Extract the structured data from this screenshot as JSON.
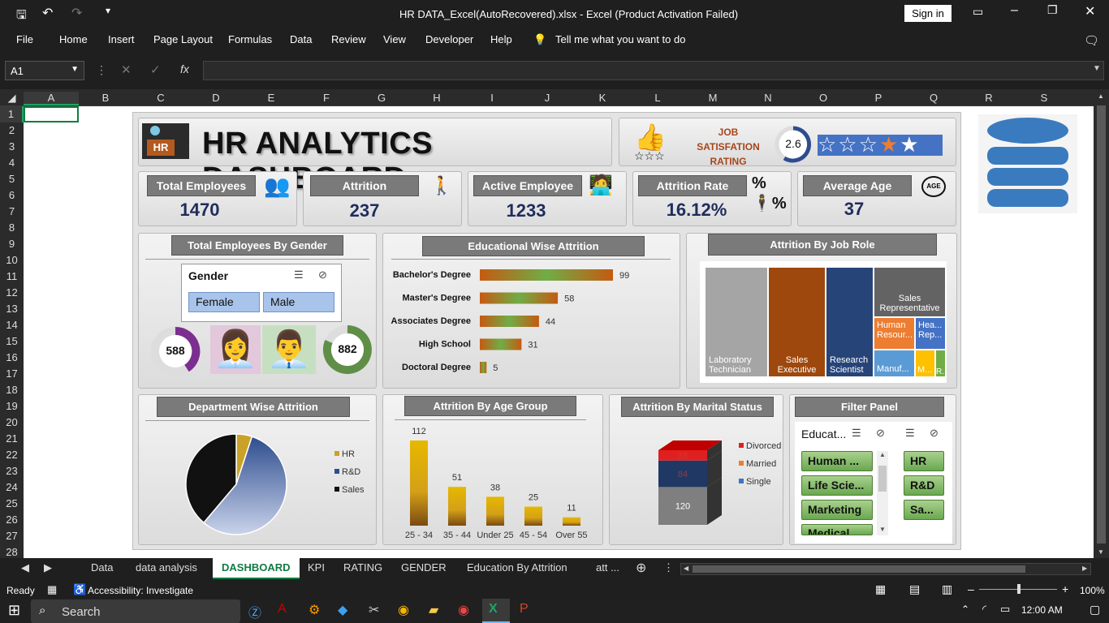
{
  "window": {
    "title": "HR DATA_Excel(AutoRecovered).xlsx  -  Excel (Product Activation Failed)",
    "sign_in": "Sign in"
  },
  "menu": [
    "File",
    "Home",
    "Insert",
    "Page Layout",
    "Formulas",
    "Data",
    "Review",
    "View",
    "Developer",
    "Help"
  ],
  "tell_me": "Tell me what you want to do",
  "formula": {
    "name_box": "A1",
    "fx": "fx"
  },
  "columns": [
    "A",
    "B",
    "C",
    "D",
    "E",
    "F",
    "G",
    "H",
    "I",
    "J",
    "K",
    "L",
    "M",
    "N",
    "O",
    "P",
    "Q",
    "R",
    "S"
  ],
  "rows": [
    "1",
    "2",
    "3",
    "4",
    "5",
    "6",
    "7",
    "8",
    "9",
    "10",
    "11",
    "12",
    "13",
    "14",
    "15",
    "16",
    "17",
    "18",
    "19",
    "20",
    "21",
    "22",
    "23",
    "24",
    "25",
    "26",
    "27",
    "28"
  ],
  "dashboard": {
    "title": "HR ANALYTICS DASHBOARD",
    "logo_text": "HR",
    "rating": {
      "l1": "JOB",
      "l2": "SATISFATION",
      "l3": "RATING",
      "value": "2.6"
    },
    "kpis": [
      {
        "label": "Total Employees",
        "value": "1470"
      },
      {
        "label": "Attrition",
        "value": "237"
      },
      {
        "label": "Active Employee",
        "value": "1233"
      },
      {
        "label": "Attrition Rate",
        "value": "16.12%"
      },
      {
        "label": "Average Age",
        "value": "37"
      }
    ],
    "age_icon": "AGE",
    "gender": {
      "title": "Total Employees By Gender",
      "slicer_title": "Gender",
      "female": "Female",
      "male": "Male",
      "female_count": "588",
      "male_count": "882"
    },
    "education": {
      "title": "Educational Wise Attrition"
    },
    "jobrole": {
      "title": "Attrition By Job Role"
    },
    "department": {
      "title": "Department Wise Attrition"
    },
    "age": {
      "title": "Attrition By Age Group"
    },
    "marital": {
      "title": "Attrition By Marital Status"
    },
    "filter": {
      "title": "Filter Panel",
      "edu_head": "Educat...",
      "edu_items": [
        "Human ...",
        "Life Scie...",
        "Marketing",
        "Medical"
      ],
      "dept_items": [
        "HR",
        "R&D",
        "Sa..."
      ]
    }
  },
  "chart_data": [
    {
      "type": "bar",
      "title": "Educational Wise Attrition",
      "categories": [
        "Bachelor's Degree",
        "Master's Degree",
        "Associates Degree",
        "High School",
        "Doctoral Degree"
      ],
      "values": [
        99,
        58,
        44,
        31,
        5
      ]
    },
    {
      "type": "table",
      "title": "Attrition By Job Role",
      "categories": [
        "Laboratory Technician",
        "Sales Executive",
        "Research Scientist",
        "Sales Representative",
        "Human Resour...",
        "Hea... Rep...",
        "Manuf...",
        "M...",
        "R..."
      ],
      "labels_shown": [
        "Laboratory Technician",
        "Sales Executive",
        "Research Scientist",
        "Sales Representative",
        "Human Resour...",
        "Hea... Rep...",
        "Manuf...",
        "M...",
        "R..."
      ]
    },
    {
      "type": "pie",
      "title": "Department Wise Attrition",
      "categories": [
        "HR",
        "R&D",
        "Sales"
      ],
      "values": [
        12,
        133,
        92
      ],
      "colors": [
        "#c9a227",
        "#2e4d8f",
        "#111111"
      ]
    },
    {
      "type": "bar",
      "title": "Attrition By Age Group",
      "categories": [
        "25 - 34",
        "35 - 44",
        "Under 25",
        "45 - 54",
        "Over 55"
      ],
      "values": [
        112,
        51,
        38,
        25,
        11
      ],
      "ylim": [
        0,
        112
      ]
    },
    {
      "type": "bar",
      "title": "Attrition By Marital Status",
      "categories": [
        "Divorced",
        "Married",
        "Single"
      ],
      "values": [
        33,
        84,
        120
      ],
      "colors": [
        "#e02020",
        "#ed7d31",
        "#4472c4"
      ],
      "labels_shown": [
        "33",
        "84",
        "120"
      ]
    }
  ],
  "sheet_tabs": [
    "Data",
    "data analysis",
    "DASHBOARD",
    "KPI",
    "RATING",
    "GENDER",
    "Education By Attrition",
    "att ..."
  ],
  "status": {
    "ready": "Ready",
    "accessibility": "Accessibility: Investigate",
    "zoom": "100%"
  },
  "taskbar": {
    "search": "Search",
    "time": "12:00 AM"
  }
}
